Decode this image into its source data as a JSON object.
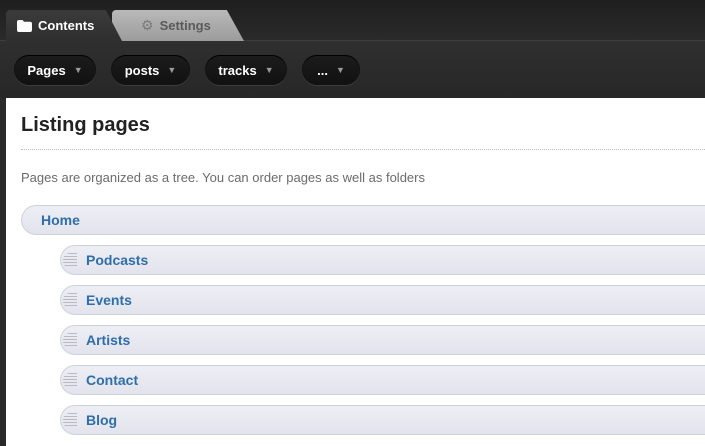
{
  "tabs": {
    "contents": "Contents",
    "settings": "Settings"
  },
  "toolbar": {
    "pills": [
      {
        "label": "Pages"
      },
      {
        "label": "posts"
      },
      {
        "label": "tracks"
      },
      {
        "label": "..."
      }
    ]
  },
  "main": {
    "title": "Listing pages",
    "description": "Pages are organized as a tree. You can order pages as well as folders",
    "root": {
      "label": "Home"
    },
    "children": [
      {
        "label": "Podcasts"
      },
      {
        "label": "Events"
      },
      {
        "label": "Artists"
      },
      {
        "label": "Contact"
      },
      {
        "label": "Blog"
      }
    ]
  },
  "icons": {
    "contents_tab": "folder-icon",
    "settings_tab": "gear-icon",
    "pill": "chevron-down-icon",
    "row": "drag-handle-icon"
  },
  "colors": {
    "link": "#2f6ea8",
    "chrome": "#2a2a2a",
    "row_bg": "#e6e7ef"
  }
}
